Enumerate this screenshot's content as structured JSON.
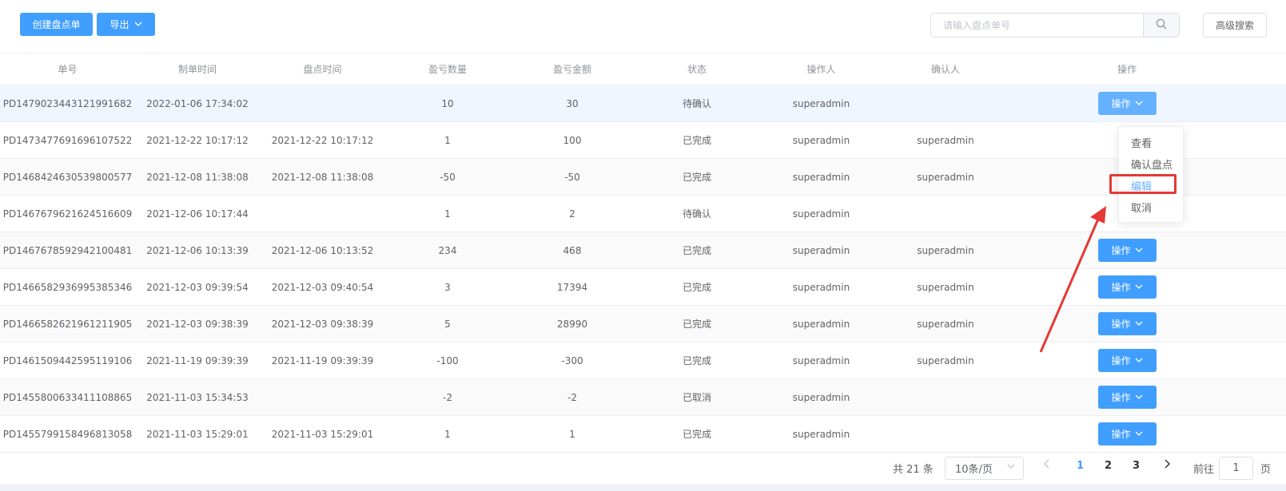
{
  "toolbar": {
    "create_label": "创建盘点单",
    "export_label": "导出",
    "search_placeholder": "请输入盘点单号",
    "advanced_search_label": "高级搜索"
  },
  "table": {
    "headers": [
      "单号",
      "制单时间",
      "盘点时间",
      "盈亏数量",
      "盈亏金额",
      "状态",
      "操作人",
      "确认人",
      "操作"
    ],
    "rows": [
      {
        "id": "PD1479023443121991682",
        "created": "2022-01-06 17:34:02",
        "counted": "",
        "qty": "10",
        "amount": "30",
        "status": "待确认",
        "operator": "superadmin",
        "confirmer": "",
        "action": "操作"
      },
      {
        "id": "PD1473477691696107522",
        "created": "2021-12-22 10:17:12",
        "counted": "2021-12-22 10:17:12",
        "qty": "1",
        "amount": "100",
        "status": "已完成",
        "operator": "superadmin",
        "confirmer": "superadmin",
        "action": "操作"
      },
      {
        "id": "PD1468424630539800577",
        "created": "2021-12-08 11:38:08",
        "counted": "2021-12-08 11:38:08",
        "qty": "-50",
        "amount": "-50",
        "status": "已完成",
        "operator": "superadmin",
        "confirmer": "superadmin",
        "action": "操作"
      },
      {
        "id": "PD1467679621624516609",
        "created": "2021-12-06 10:17:44",
        "counted": "",
        "qty": "1",
        "amount": "2",
        "status": "待确认",
        "operator": "superadmin",
        "confirmer": "",
        "action": "操作"
      },
      {
        "id": "PD1467678592942100481",
        "created": "2021-12-06 10:13:39",
        "counted": "2021-12-06 10:13:52",
        "qty": "234",
        "amount": "468",
        "status": "已完成",
        "operator": "superadmin",
        "confirmer": "superadmin",
        "action": "操作"
      },
      {
        "id": "PD1466582936995385346",
        "created": "2021-12-03 09:39:54",
        "counted": "2021-12-03 09:40:54",
        "qty": "3",
        "amount": "17394",
        "status": "已完成",
        "operator": "superadmin",
        "confirmer": "superadmin",
        "action": "操作"
      },
      {
        "id": "PD1466582621961211905",
        "created": "2021-12-03 09:38:39",
        "counted": "2021-12-03 09:38:39",
        "qty": "5",
        "amount": "28990",
        "status": "已完成",
        "operator": "superadmin",
        "confirmer": "superadmin",
        "action": "操作"
      },
      {
        "id": "PD1461509442595119106",
        "created": "2021-11-19 09:39:39",
        "counted": "2021-11-19 09:39:39",
        "qty": "-100",
        "amount": "-300",
        "status": "已完成",
        "operator": "superadmin",
        "confirmer": "superadmin",
        "action": "操作"
      },
      {
        "id": "PD1455800633411108865",
        "created": "2021-11-03 15:34:53",
        "counted": "",
        "qty": "-2",
        "amount": "-2",
        "status": "已取消",
        "operator": "superadmin",
        "confirmer": "",
        "action": "操作"
      },
      {
        "id": "PD1455799158496813058",
        "created": "2021-11-03 15:29:01",
        "counted": "2021-11-03 15:29:01",
        "qty": "1",
        "amount": "1",
        "status": "已完成",
        "operator": "superadmin",
        "confirmer": "",
        "action": "操作"
      }
    ]
  },
  "dropdown": {
    "items": [
      "查看",
      "确认盘点",
      "编辑",
      "取消"
    ],
    "active_item": "编辑"
  },
  "pagination": {
    "total": "共 21 条",
    "page_size": "10条/页",
    "pages": [
      "1",
      "2",
      "3"
    ],
    "current_page": "1",
    "goto_label": "前往",
    "goto_value": "1",
    "goto_suffix": "页"
  },
  "colors": {
    "primary": "#409eff",
    "primary_light": "#66b1ff",
    "highlight_red": "#e53935"
  },
  "icons": {
    "search": "search-icon",
    "chevron_down": "chevron-down-icon",
    "chevron_left": "chevron-left-icon",
    "chevron_right": "chevron-right-icon"
  }
}
